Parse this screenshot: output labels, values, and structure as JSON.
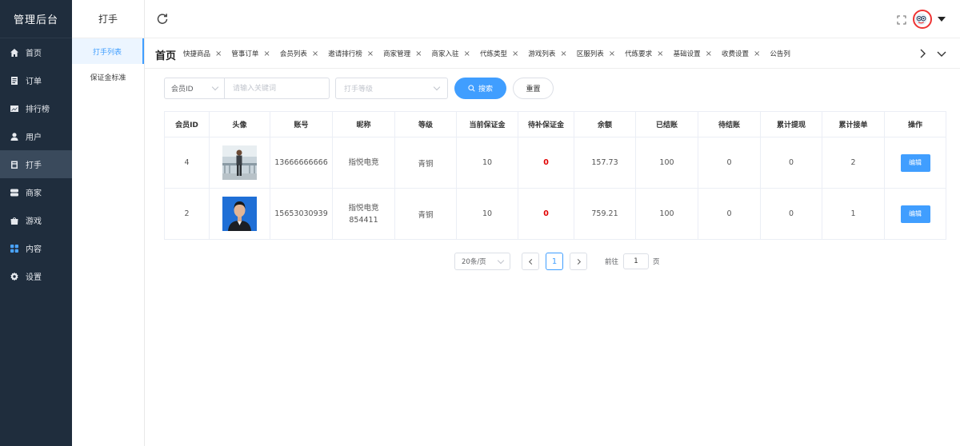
{
  "app": {
    "title": "管理后台"
  },
  "sidebar": {
    "items": [
      {
        "label": "首页",
        "icon": "home-icon"
      },
      {
        "label": "订单",
        "icon": "document-icon"
      },
      {
        "label": "排行榜",
        "icon": "chart-icon"
      },
      {
        "label": "用户",
        "icon": "user-icon"
      },
      {
        "label": "打手",
        "icon": "tablet-icon",
        "active": true
      },
      {
        "label": "商家",
        "icon": "server-icon"
      },
      {
        "label": "游戏",
        "icon": "bag-icon"
      },
      {
        "label": "内容",
        "icon": "grid-icon"
      },
      {
        "label": "设置",
        "icon": "gear-icon"
      }
    ]
  },
  "submenu": {
    "title": "打手",
    "items": [
      {
        "label": "打手列表",
        "active": true
      },
      {
        "label": "保证金标准"
      }
    ]
  },
  "tagsbar": {
    "home": "首页",
    "tags": [
      "快捷商品",
      "管事订单",
      "会员列表",
      "邀请排行榜",
      "商家管理",
      "商家入驻",
      "代练类型",
      "游戏列表",
      "区服列表",
      "代练要求",
      "基础设置",
      "收费设置",
      "公告列"
    ]
  },
  "filter": {
    "member_select": "会员ID",
    "keyword_placeholder": "请输入关键词",
    "level_placeholder": "打手等级",
    "search_label": "搜索",
    "reset_label": "重置"
  },
  "table": {
    "headers": [
      "会员ID",
      "头像",
      "账号",
      "昵称",
      "等级",
      "当前保证金",
      "待补保证金",
      "余额",
      "已结账",
      "待结账",
      "累计提现",
      "累计接单",
      "操作"
    ],
    "rows": [
      {
        "id": "4",
        "account": "13666666666",
        "nickname": "指悦电竞",
        "level": "青铜",
        "deposit": "10",
        "deposit_due": "0",
        "balance": "157.73",
        "settled": "100",
        "pending": "0",
        "withdrawn": "0",
        "orders": "2",
        "action": "编辑"
      },
      {
        "id": "2",
        "account": "15653030939",
        "nickname": "指悦电竞854411",
        "level": "青铜",
        "deposit": "10",
        "deposit_due": "0",
        "balance": "759.21",
        "settled": "100",
        "pending": "0",
        "withdrawn": "0",
        "orders": "1",
        "action": "编辑"
      }
    ]
  },
  "pagination": {
    "page_size": "20条/页",
    "current_page": "1",
    "goto_label": "前往",
    "goto_value": "1",
    "goto_unit": "页"
  },
  "colors": {
    "sidebar_bg": "#1f2d3d",
    "accent": "#409eff",
    "danger": "#e10000"
  }
}
